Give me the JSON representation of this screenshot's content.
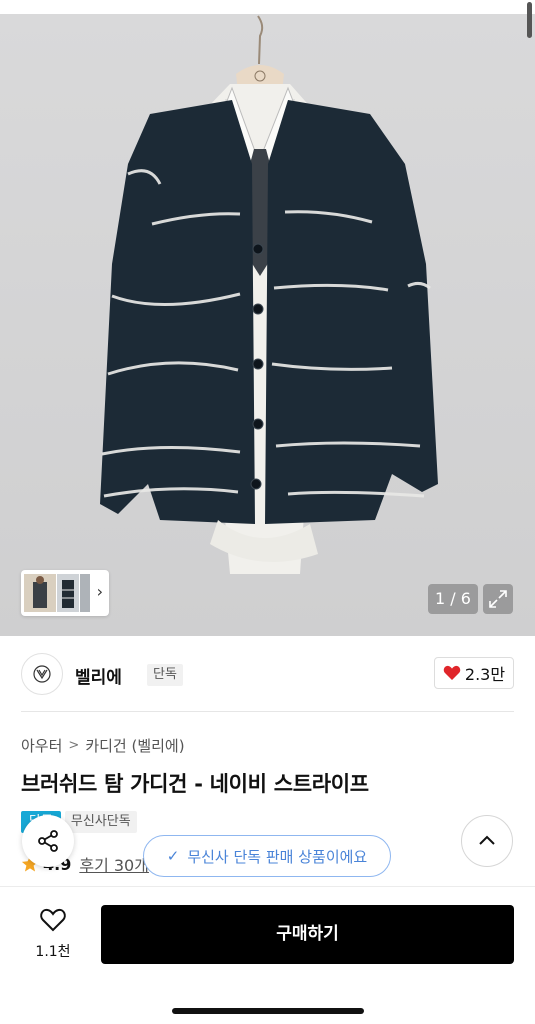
{
  "gallery": {
    "counter": "1 / 6"
  },
  "brand": {
    "name": "벨리에",
    "badge": "단독"
  },
  "like": {
    "count": "2.3만",
    "color": "#e0252a"
  },
  "breadcrumb": {
    "items": [
      "아우터",
      "카디건 (벨리에)"
    ]
  },
  "product": {
    "title": "브러쉬드 탐 가디건 - 네이비 스트라이프",
    "badges": {
      "blue": "단독",
      "gray": "무신사단독"
    },
    "rating": "4.9",
    "reviews": "후기 30개"
  },
  "toast": {
    "text": "무신사 단독 판매 상품이에요"
  },
  "bottom": {
    "wish_count": "1.1천",
    "buy_label": "구매하기"
  },
  "colors": {
    "accent_blue": "#17a8d6",
    "toast_blue": "#4a84d8",
    "star": "#f5a623"
  },
  "icons": [
    "hanger-icon",
    "chevron-right-icon",
    "expand-icon",
    "heart-icon",
    "share-icon",
    "chevron-up-icon",
    "star-icon",
    "check-icon",
    "heart-outline-icon"
  ]
}
